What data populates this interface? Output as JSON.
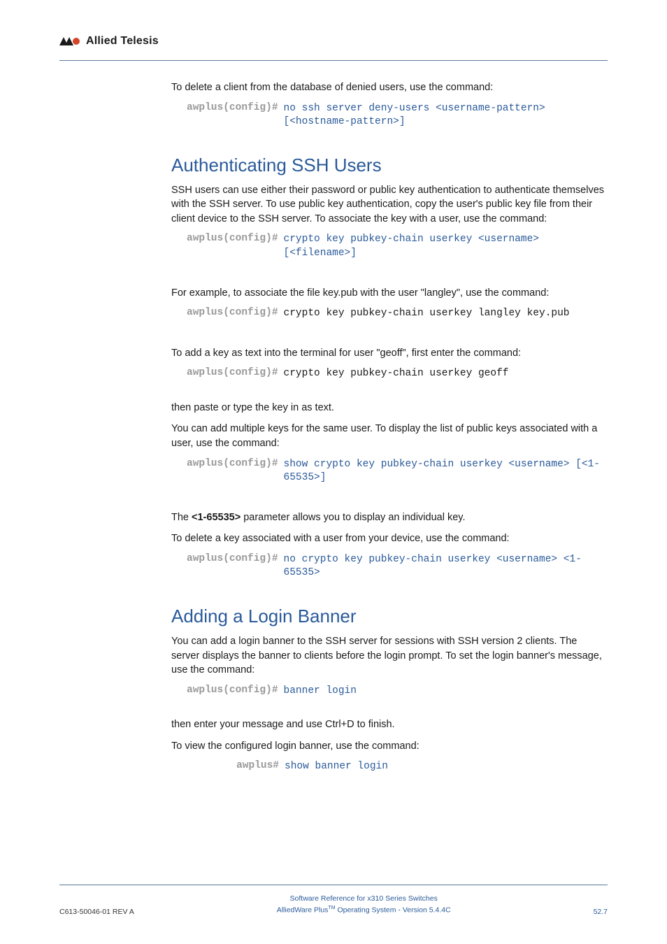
{
  "logo_text": "Allied Telesis",
  "p1": "To delete a client from the database of denied users, use the command:",
  "cmd1_prompt": "awplus(config)#",
  "cmd1": "no ssh server deny-users <username-pattern> [<hostname-pattern>]",
  "h2a": "Authenticating SSH Users",
  "p2": "SSH users can use either their password or public key authentication to authenticate themselves with the SSH server. To use public key authentication, copy the user's public key file from their client device to the SSH server. To associate the key with a user, use the command:",
  "cmd2_prompt": "awplus(config)#",
  "cmd2": "crypto key pubkey-chain userkey <username> [<filename>]",
  "p3": "For example, to associate the file key.pub with the user \"langley\", use the command:",
  "cmd3_prompt": "awplus(config)#",
  "cmd3": "crypto key pubkey-chain userkey langley key.pub",
  "p4": "To add a key as text into the terminal for user \"geoff\", first enter the command:",
  "cmd4_prompt": "awplus(config)#",
  "cmd4": "crypto key pubkey-chain userkey geoff",
  "p5": "then paste or type the key in as text.",
  "p6": "You can add multiple keys for the same user. To display the list of public keys associated with a user, use the command:",
  "cmd5_prompt": "awplus(config)#",
  "cmd5": "show crypto key pubkey-chain userkey <username> [<1-65535>]",
  "p7a": "The ",
  "p7b": "<1-65535>",
  "p7c": " parameter allows you to display an individual key.",
  "p8": "To delete a key associated with a user from your device, use the command:",
  "cmd6_prompt": "awplus(config)#",
  "cmd6": "no crypto key pubkey-chain userkey <username> <1-65535>",
  "h2b": "Adding a Login Banner",
  "p9": "You can add a login banner to the SSH server for sessions with SSH version 2 clients. The server displays the banner to clients before the login prompt. To set the login banner's message, use the command:",
  "cmd7_prompt": "awplus(config)#",
  "cmd7": "banner login",
  "p10": "then enter your message and use Ctrl+D to finish.",
  "p11": "To view the configured login banner, use the command:",
  "cmd8_prompt": "awplus#",
  "cmd8": "show banner login",
  "footer": {
    "left": "C613-50046-01 REV A",
    "line1": "Software Reference for x310 Series Switches",
    "line2a": "AlliedWare Plus",
    "line2b": "TM",
    "line2c": " Operating System - Version 5.4.4C",
    "right": "52.7"
  }
}
